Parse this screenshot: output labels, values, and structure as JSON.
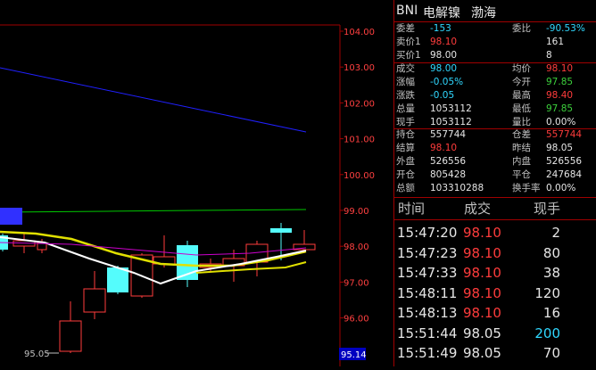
{
  "chart": {
    "y_axis_labels": [
      "104.00",
      "103.00",
      "102.00",
      "101.00",
      "100.00",
      "99.00",
      "98.00",
      "97.00",
      "96.00"
    ],
    "low_label": "95.05",
    "current_price_tag": "95.14"
  },
  "quote": {
    "title_code": "BNI",
    "title_name": "电解镍",
    "title_exchange": "渤海",
    "rows_top": [
      {
        "l1": "委差",
        "v1": "-153",
        "l2": "委比",
        "v2": "-90.53%"
      },
      {
        "l1": "卖价1",
        "v1": "98.10",
        "l2": "",
        "v2": "161"
      },
      {
        "l1": "买价1",
        "v1": "98.00",
        "l2": "",
        "v2": "8"
      }
    ],
    "rows_mid": [
      {
        "l1": "成交",
        "v1": "98.00",
        "l2": "均价",
        "v2": "98.10"
      },
      {
        "l1": "涨幅",
        "v1": "-0.05%",
        "l2": "今开",
        "v2": "97.85"
      },
      {
        "l1": "涨跌",
        "v1": "-0.05",
        "l2": "最高",
        "v2": "98.40"
      },
      {
        "l1": "总量",
        "v1": "1053112",
        "l2": "最低",
        "v2": "97.85"
      },
      {
        "l1": "现手",
        "v1": "1053112",
        "l2": "量比",
        "v2": "0.00%"
      }
    ],
    "rows_bottom": [
      {
        "l1": "持仓",
        "v1": "557744",
        "l2": "仓差",
        "v2": "557744"
      },
      {
        "l1": "结算",
        "v1": "98.10",
        "l2": "昨结",
        "v2": "98.05"
      },
      {
        "l1": "外盘",
        "v1": "526556",
        "l2": "内盘",
        "v2": "526556"
      },
      {
        "l1": "开仓",
        "v1": "805428",
        "l2": "平仓",
        "v2": "247684"
      },
      {
        "l1": "总额",
        "v1": "103310288",
        "l2": "换手率",
        "v2": "0.00%"
      }
    ],
    "trades_header": {
      "time": "时间",
      "price": "成交",
      "volume": "现手"
    },
    "trades": [
      {
        "time": "15:47:20",
        "price": "98.10",
        "volume": "2"
      },
      {
        "time": "15:47:23",
        "price": "98.10",
        "volume": "80"
      },
      {
        "time": "15:47:33",
        "price": "98.10",
        "volume": "38"
      },
      {
        "time": "15:48:11",
        "price": "98.10",
        "volume": "120"
      },
      {
        "time": "15:48:13",
        "price": "98.10",
        "volume": "16"
      },
      {
        "time": "15:51:44",
        "price": "98.05",
        "volume": "200"
      },
      {
        "time": "15:51:49",
        "price": "98.05",
        "volume": "70"
      }
    ]
  },
  "colors": {
    "up": "#ff3c3c",
    "down": "#54fcfc",
    "ma5": "#ffffff",
    "ma10": "#ffff00",
    "ma20": "#ff00ff",
    "ma60": "#00ff00",
    "trend": "#2020ff"
  }
}
